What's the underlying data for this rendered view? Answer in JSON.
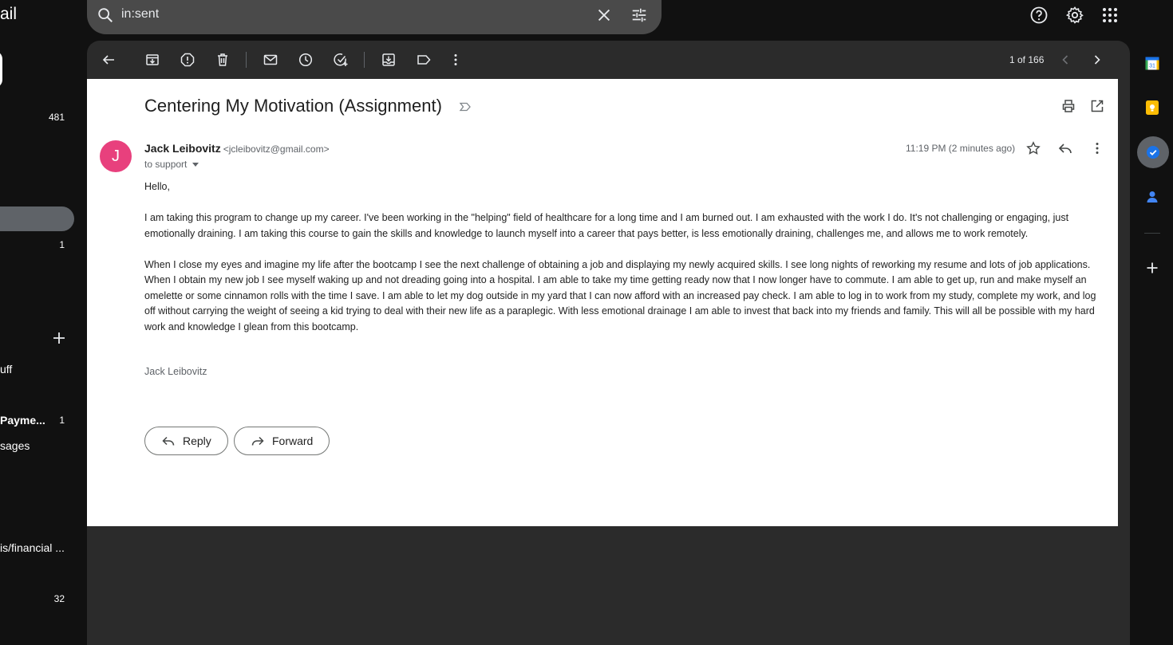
{
  "app": {
    "logo_fragment": "ail"
  },
  "search": {
    "query": "in:sent"
  },
  "sidebar": {
    "counts": {
      "inbox": "481",
      "item_a": "1",
      "payments": "1",
      "bottom": "32"
    },
    "labels": {
      "stuff": "uff",
      "payments": "Payme...",
      "messages": "sages",
      "financial": "is/financial ..."
    }
  },
  "account": {
    "initial": "J"
  },
  "toolbar": {
    "pager": "1 of 166"
  },
  "email": {
    "subject": "Centering My Motivation (Assignment)",
    "sender_name": "Jack Leibovitz",
    "sender_email": "<jcleibovitz@gmail.com>",
    "to": "to support",
    "timestamp": "11:19 PM (2 minutes ago)",
    "greeting": "Hello,",
    "paragraph1": "I am taking this program to change up my career. I've been working in the \"helping\" field of healthcare for a long time and I am burned out. I am exhausted with the work I do. It's not challenging or engaging, just emotionally draining. I am taking this course to gain the skills and knowledge to launch myself into a career that pays better, is less emotionally draining, challenges me, and allows me to work remotely.",
    "paragraph2": "When I close my eyes and imagine my life after the bootcamp I see the next challenge of obtaining a job and displaying my newly acquired skills. I see long nights of reworking my resume and lots of job applications. When I obtain my new job I see myself waking up and not dreading going into a hospital. I am able to take my time getting ready now that I now longer have to commute. I am able to get up, run and make myself an omelette or some cinnamon rolls with the time I save. I am able to let my dog outside in my yard that I can now afford with an increased pay check. I am able to log in to work from my study, complete my work, and log off without carrying the weight of seeing a kid trying to deal with their new life as a paraplegic. With less emotional drainage I am able to invest that back into my friends and family. This will all be possible with my hard work and knowledge I glean from this bootcamp.",
    "signature": "Jack Leibovitz",
    "reply_label": "Reply",
    "forward_label": "Forward"
  },
  "rail": {
    "calendar_day": "31"
  },
  "colors": {
    "avatar": "#e8407d",
    "panel": "#2b2b2b",
    "background": "#111111"
  }
}
